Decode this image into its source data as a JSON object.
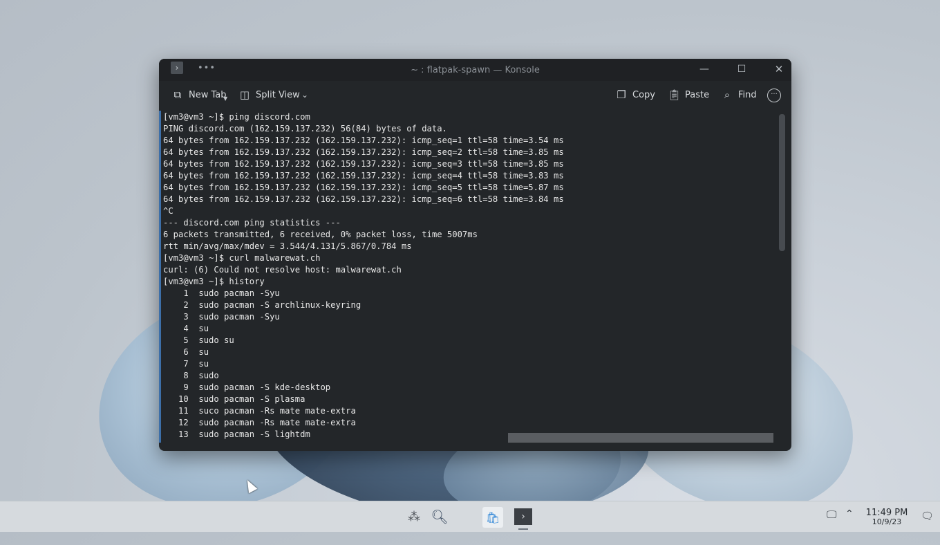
{
  "window": {
    "title": "~ : flatpak-spawn — Konsole",
    "app_icon": "›",
    "menu_dots": "•••",
    "controls": {
      "minimize": "—",
      "maximize": "☐",
      "close": "✕"
    }
  },
  "toolbar": {
    "new_tab": "New Tab",
    "split_view": "Split View",
    "copy": "Copy",
    "paste": "Paste",
    "find": "Find"
  },
  "terminal": {
    "lines": [
      "[vm3@vm3 ~]$ ping discord.com",
      "PING discord.com (162.159.137.232) 56(84) bytes of data.",
      "64 bytes from 162.159.137.232 (162.159.137.232): icmp_seq=1 ttl=58 time=3.54 ms",
      "64 bytes from 162.159.137.232 (162.159.137.232): icmp_seq=2 ttl=58 time=3.85 ms",
      "64 bytes from 162.159.137.232 (162.159.137.232): icmp_seq=3 ttl=58 time=3.85 ms",
      "64 bytes from 162.159.137.232 (162.159.137.232): icmp_seq=4 ttl=58 time=3.83 ms",
      "64 bytes from 162.159.137.232 (162.159.137.232): icmp_seq=5 ttl=58 time=5.87 ms",
      "64 bytes from 162.159.137.232 (162.159.137.232): icmp_seq=6 ttl=58 time=3.84 ms",
      "^C",
      "--- discord.com ping statistics ---",
      "6 packets transmitted, 6 received, 0% packet loss, time 5007ms",
      "rtt min/avg/max/mdev = 3.544/4.131/5.867/0.784 ms",
      "[vm3@vm3 ~]$ curl malwarewat.ch",
      "curl: (6) Could not resolve host: malwarewat.ch",
      "[vm3@vm3 ~]$ history",
      "    1  sudo pacman -Syu",
      "    2  sudo pacman -S archlinux-keyring",
      "    3  sudo pacman -Syu",
      "    4  su",
      "    5  sudo su",
      "    6  su",
      "    7  su",
      "    8  sudo",
      "    9  sudo pacman -S kde-desktop",
      "   10  sudo pacman -S plasma",
      "   11  suco pacman -Rs mate mate-extra",
      "   12  sudo pacman -Rs mate mate-extra",
      "   13  sudo pacman -S lightdm"
    ]
  },
  "taskbar": {
    "clock_time": "11:49 PM",
    "clock_date": "10/9/23"
  }
}
